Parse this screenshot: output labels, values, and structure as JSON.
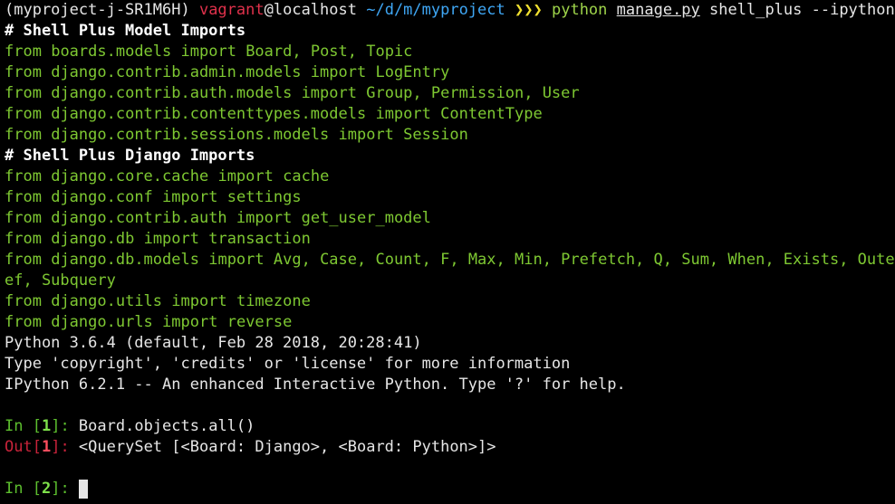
{
  "prompt": {
    "venv": "(myproject-j-SR1M6H)",
    "user": "vagrant",
    "at": "@",
    "host": "localhost",
    "cwd": "~/d/m/myproject",
    "arrows": "❯❯❯",
    "cmd_python": "python",
    "cmd_script": "manage.py",
    "cmd_args": "shell_plus --ipython"
  },
  "sections": {
    "model_imports_header": "# Shell Plus Model Imports",
    "django_imports_header": "# Shell Plus Django Imports"
  },
  "model_imports": [
    {
      "pre": "from",
      "mod": "boards.models",
      "kw": "import",
      "names": "Board, Post, Topic"
    },
    {
      "pre": "from",
      "mod": "django.contrib.admin.models",
      "kw": "import",
      "names": "LogEntry"
    },
    {
      "pre": "from",
      "mod": "django.contrib.auth.models",
      "kw": "import",
      "names": "Group, Permission, User"
    },
    {
      "pre": "from",
      "mod": "django.contrib.contenttypes.models",
      "kw": "import",
      "names": "ContentType"
    },
    {
      "pre": "from",
      "mod": "django.contrib.sessions.models",
      "kw": "import",
      "names": "Session"
    }
  ],
  "django_imports": [
    {
      "pre": "from",
      "mod": "django.core.cache",
      "kw": "import",
      "names": "cache"
    },
    {
      "pre": "from",
      "mod": "django.conf",
      "kw": "import",
      "names": "settings"
    },
    {
      "pre": "from",
      "mod": "django.contrib.auth",
      "kw": "import",
      "names": "get_user_model"
    },
    {
      "pre": "from",
      "mod": "django.db",
      "kw": "import",
      "names": "transaction"
    },
    {
      "pre": "from",
      "mod": "django.db.models",
      "kw": "import",
      "names": "Avg, Case, Count, F, Max, Min, Prefetch, Q, Sum, When, Exists, OuterR"
    },
    {
      "pre": "from",
      "mod": "django.utils",
      "kw": "import",
      "names": "timezone"
    },
    {
      "pre": "from",
      "mod": "django.urls",
      "kw": "import",
      "names": "reverse"
    }
  ],
  "wrap_continuation": "ef, Subquery",
  "banner": [
    "Python 3.6.4 (default, Feb 28 2018, 20:28:41)",
    "Type 'copyright', 'credits' or 'license' for more information",
    "IPython 6.2.1 -- An enhanced Interactive Python. Type '?' for help."
  ],
  "session": {
    "in1_label": "In [",
    "in1_num": "1",
    "in1_close": "]: ",
    "in1_code": "Board.objects.all()",
    "out1_label": "Out[",
    "out1_num": "1",
    "out1_close": "]: ",
    "out1_value": "<QuerySet [<Board: Django>, <Board: Python>]>",
    "in2_label": "In [",
    "in2_num": "2",
    "in2_close": "]: "
  },
  "colors": {
    "background": "#000000",
    "green_text": "#7ec832",
    "user_red": "#e0314b",
    "path_blue": "#3fa7f5",
    "arrows_yellow": "#f0e030"
  }
}
